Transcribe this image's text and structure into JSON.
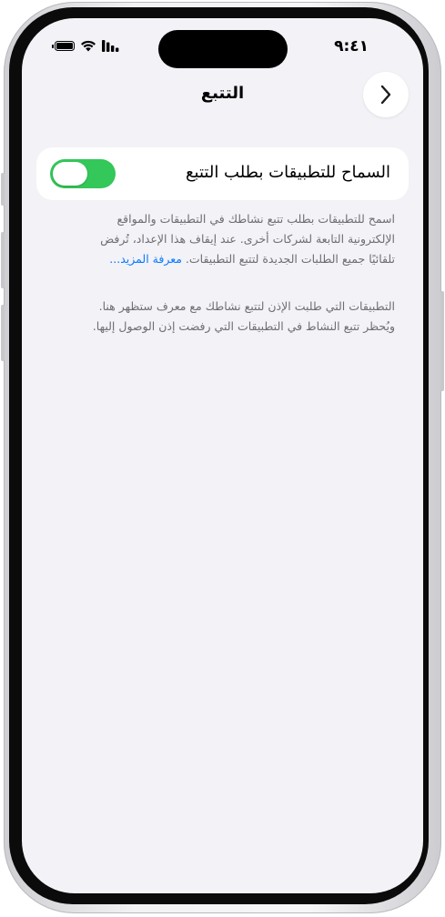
{
  "status_bar": {
    "time": "٩:٤١",
    "battery_level": 1.0,
    "icons": [
      "cellular-signal-icon",
      "wifi-icon",
      "battery-icon"
    ]
  },
  "nav": {
    "title": "التتبع",
    "back_icon": "chevron-right-icon"
  },
  "toggle_row": {
    "label": "السماح للتطبيقات بطلب التتبع",
    "state": "on",
    "on_color": "#34c759"
  },
  "description": {
    "text": "اسمح للتطبيقات بطلب تتبع نشاطك في التطبيقات والمواقع الإلكترونية التابعة لشركات أخرى. عند إيقاف هذا الإعداد، تُرفض تلقائيًا جميع الطلبات الجديدة لتتبع التطبيقات.",
    "link": "معرفة المزيد..."
  },
  "apps_note": {
    "text": "التطبيقات التي طلبت الإذن لتتبع نشاطك مع معرف ستظهر هنا. ويُحظر تتبع النشاط في التطبيقات التي رفضت إذن الوصول إليها."
  },
  "colors": {
    "screen_background": "#f2f2f7",
    "link": "#0a7aff",
    "footer_text": "#6d6d72"
  }
}
